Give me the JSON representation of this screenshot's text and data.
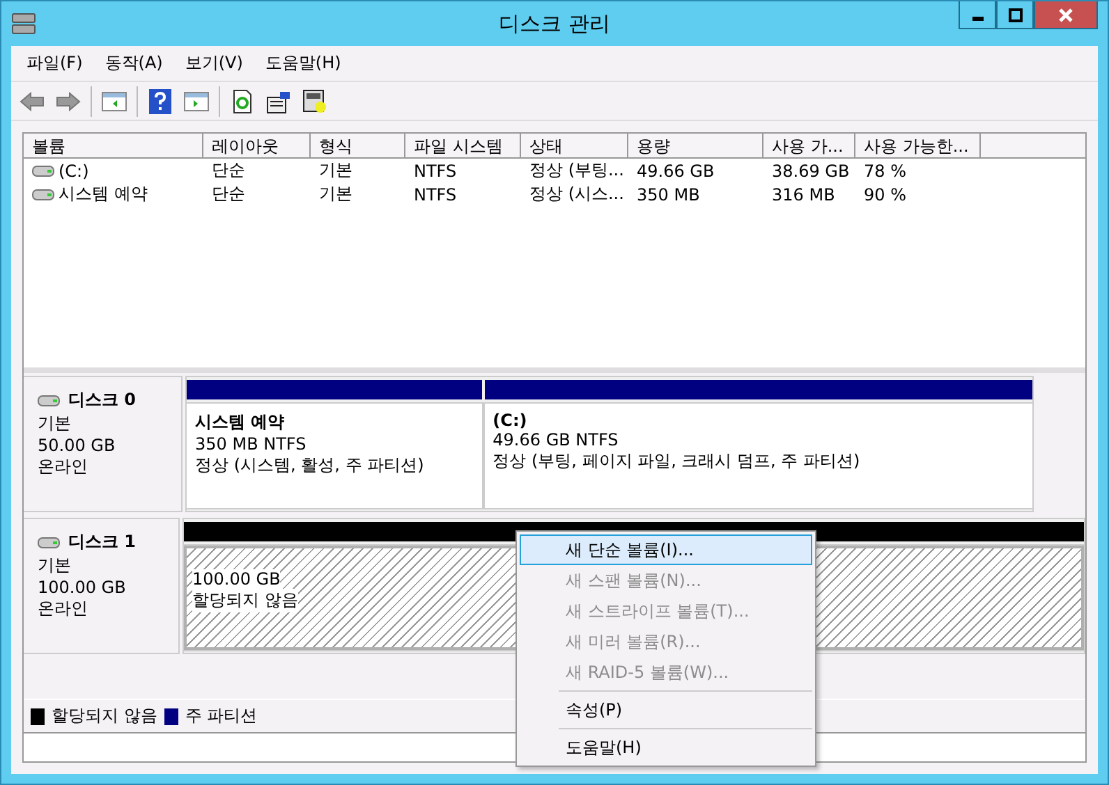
{
  "window": {
    "title": "디스크 관리"
  },
  "menu": [
    "파일(F)",
    "동작(A)",
    "보기(V)",
    "도움말(H)"
  ],
  "volumes": {
    "columns": [
      "볼륨",
      "레이아웃",
      "형식",
      "파일 시스템",
      "상태",
      "용량",
      "사용 가...",
      "사용 가능한..."
    ],
    "rows": [
      [
        "(C:)",
        "단순",
        "기본",
        "NTFS",
        "정상 (부팅...",
        "49.66 GB",
        "38.69 GB",
        "78 %"
      ],
      [
        "시스템 예약",
        "단순",
        "기본",
        "NTFS",
        "정상 (시스...",
        "350 MB",
        "316 MB",
        "90 %"
      ]
    ]
  },
  "disks": [
    {
      "name": "디스크 0",
      "lines": [
        "기본",
        "50.00 GB",
        "온라인"
      ],
      "partitions": [
        {
          "kind": "primary",
          "name": "시스템 예약",
          "lines": [
            "350 MB NTFS",
            "정상 (시스템, 활성, 주 파티션)"
          ]
        },
        {
          "kind": "primary",
          "name": "(C:)",
          "lines": [
            "49.66 GB NTFS",
            "정상 (부팅, 페이지 파일, 크래시 덤프, 주 파티션)"
          ]
        }
      ]
    },
    {
      "name": "디스크 1",
      "lines": [
        "기본",
        "100.00 GB",
        "온라인"
      ],
      "partitions": [
        {
          "kind": "unallocated",
          "lines": [
            "100.00 GB",
            "할당되지 않음"
          ]
        }
      ]
    }
  ],
  "context_menu": [
    {
      "kind": "item",
      "label": "새 단순 볼륨(I)...",
      "disabled": false,
      "selected": true
    },
    {
      "kind": "item",
      "label": "새 스팬 볼륨(N)...",
      "disabled": true,
      "selected": false
    },
    {
      "kind": "item",
      "label": "새 스트라이프 볼륨(T)...",
      "disabled": true,
      "selected": false
    },
    {
      "kind": "item",
      "label": "새 미러 볼륨(R)...",
      "disabled": true,
      "selected": false
    },
    {
      "kind": "item",
      "label": "새 RAID-5 볼륨(W)...",
      "disabled": true,
      "selected": false
    },
    {
      "kind": "separator"
    },
    {
      "kind": "item",
      "label": "속성(P)",
      "disabled": false,
      "selected": false
    },
    {
      "kind": "separator"
    },
    {
      "kind": "item",
      "label": "도움말(H)",
      "disabled": false,
      "selected": false
    }
  ],
  "legend": [
    {
      "label": "할당되지 않음",
      "color": "#000000"
    },
    {
      "label": "주 파티션",
      "color": "#000080"
    }
  ]
}
